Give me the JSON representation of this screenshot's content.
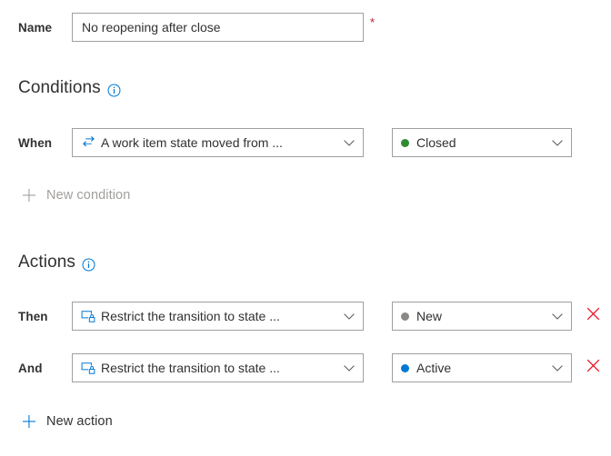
{
  "name_row": {
    "label": "Name",
    "value": "No reopening after close",
    "placeholder": "",
    "required_marker": "*"
  },
  "conditions": {
    "heading": "Conditions",
    "info_icon": "info-circle-icon",
    "rows": [
      {
        "label": "When",
        "rule": {
          "icon": "transition-arrows-icon",
          "text": "A work item state moved from ..."
        },
        "value": {
          "text": "Closed",
          "dot_color": "#2e8b32"
        }
      }
    ],
    "new_button": {
      "label": "New condition",
      "icon": "plus-icon",
      "enabled": false
    }
  },
  "actions": {
    "heading": "Actions",
    "info_icon": "info-circle-icon",
    "rows": [
      {
        "label": "Then",
        "rule": {
          "icon": "restrict-transition-icon",
          "text": "Restrict the transition to state ..."
        },
        "value": {
          "text": "New",
          "dot_color": "#8a8886"
        },
        "delete_icon": "close-x-icon"
      },
      {
        "label": "And",
        "rule": {
          "icon": "restrict-transition-icon",
          "text": "Restrict the transition to state ..."
        },
        "value": {
          "text": "Active",
          "dot_color": "#0078d4"
        },
        "delete_icon": "close-x-icon"
      }
    ],
    "new_button": {
      "label": "New action",
      "icon": "plus-icon",
      "enabled": true
    }
  },
  "colors": {
    "accent": "#0078d4",
    "required": "#a4262c",
    "border": "#a19f9d",
    "text": "#323130",
    "disabled_text": "#a19f9d",
    "delete_x": "#e81123"
  }
}
